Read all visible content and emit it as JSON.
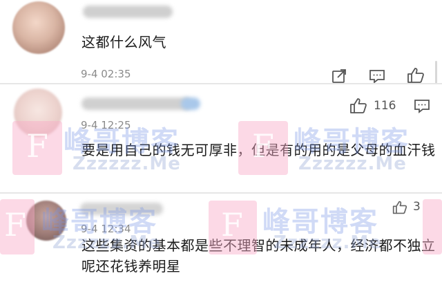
{
  "comments": [
    {
      "text": "这都什么风气",
      "time": "9-4 02:35",
      "actions": [
        "share-icon",
        "comment-icon",
        "like-icon"
      ]
    },
    {
      "text": "要是用自己的钱无可厚非，但是有的用的是父母的血汗钱",
      "time": "9-4 12:25",
      "likes": "116",
      "actions": [
        "like-icon",
        "comment-icon"
      ]
    },
    {
      "text": "这些集资的基本都是些不理智的未成年人，经济都不独立呢还花钱养明星",
      "time": "9-4 12:34",
      "likes": "3",
      "actions": [
        "like-icon"
      ]
    }
  ],
  "watermark": {
    "letter": "F",
    "title": "峰哥博客",
    "url": "Zzzzzz.Me",
    "color": "#f8aac8"
  }
}
